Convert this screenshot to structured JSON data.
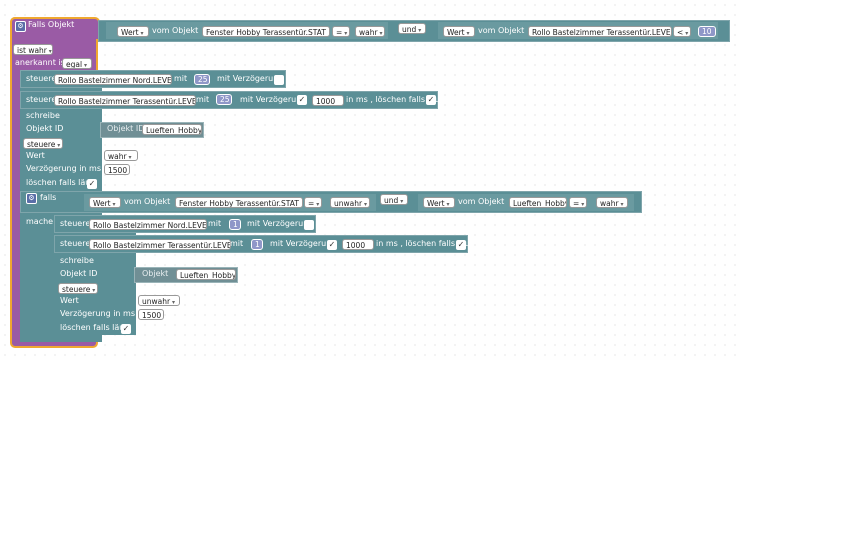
{
  "header": {
    "title": "Falls Objekt",
    "ist_wahr": "ist wahr",
    "anerkannt_ist": "anerkannt ist",
    "egal": "egal"
  },
  "cond1": {
    "wert_label": "Wert",
    "vom_objekt": "vom Objekt",
    "obj1": "Fenster Hobby Terassentür.STAT",
    "op1": "=",
    "val1": "wahr",
    "und": "und",
    "obj2": "Rollo Bastelzimmer Terassentür.LEVE",
    "op2": "<",
    "num2": "10"
  },
  "block1": {
    "steuere": "steuere",
    "target": "Rollo Bastelzimmer Nord.LEVE",
    "mit": "mit",
    "value": "25",
    "mit_verz": "mit Verzögerung"
  },
  "block2": {
    "steuere": "steuere",
    "target": "Rollo Bastelzimmer Terassentür.LEVE",
    "mit": "mit",
    "value": "25",
    "mit_verz": "mit Verzögerung",
    "delay": "1000",
    "suffix": "in ms , löschen falls läu"
  },
  "write1": {
    "schreibe": "schreibe",
    "objekt_id": "Objekt ID",
    "objekt_label": "Objekt ID",
    "objekt_value": "Lueften_Hobby",
    "steuere": "steuere",
    "wert": "Wert",
    "wert_value": "wahr",
    "verz": "Verzögerung in ms",
    "verz_value": "1500",
    "loeschen": "löschen falls läu"
  },
  "falls": {
    "label": "falls",
    "wert_label": "Wert",
    "vom_objekt": "vom Objekt",
    "obj1": "Fenster Hobby Terassentür.STAT",
    "op1": "=",
    "val1": "unwahr",
    "und": "und",
    "obj2": "Lueften_Hobby",
    "op2": "=",
    "val2": "wahr",
    "mache": "mache"
  },
  "block3": {
    "steuere": "steuere",
    "target": "Rollo Bastelzimmer Nord.LEVE",
    "mit": "mit",
    "value": "1",
    "mit_verz": "mit Verzögerung"
  },
  "block4": {
    "steuere": "steuere",
    "target": "Rollo Bastelzimmer Terassentür.LEVE",
    "mit": "mit",
    "value": "1",
    "mit_verz": "mit Verzögerung",
    "delay": "1000",
    "suffix": "in ms , löschen falls läu"
  },
  "write2": {
    "schreibe": "schreibe",
    "objekt_id": "Objekt ID",
    "objekt_label": "Objekt",
    "objekt_value": "Lueften_Hobby",
    "steuere": "steuere",
    "wert": "Wert",
    "wert_value": "unwahr",
    "verz": "Verzögerung in ms",
    "verz_value": "1500",
    "loeschen": "löschen falls läu"
  },
  "colors": {
    "trigger": "#9a5ba5",
    "action": "#5b8f96",
    "number": "#6a4fa3",
    "highlight": "#f0a830"
  }
}
